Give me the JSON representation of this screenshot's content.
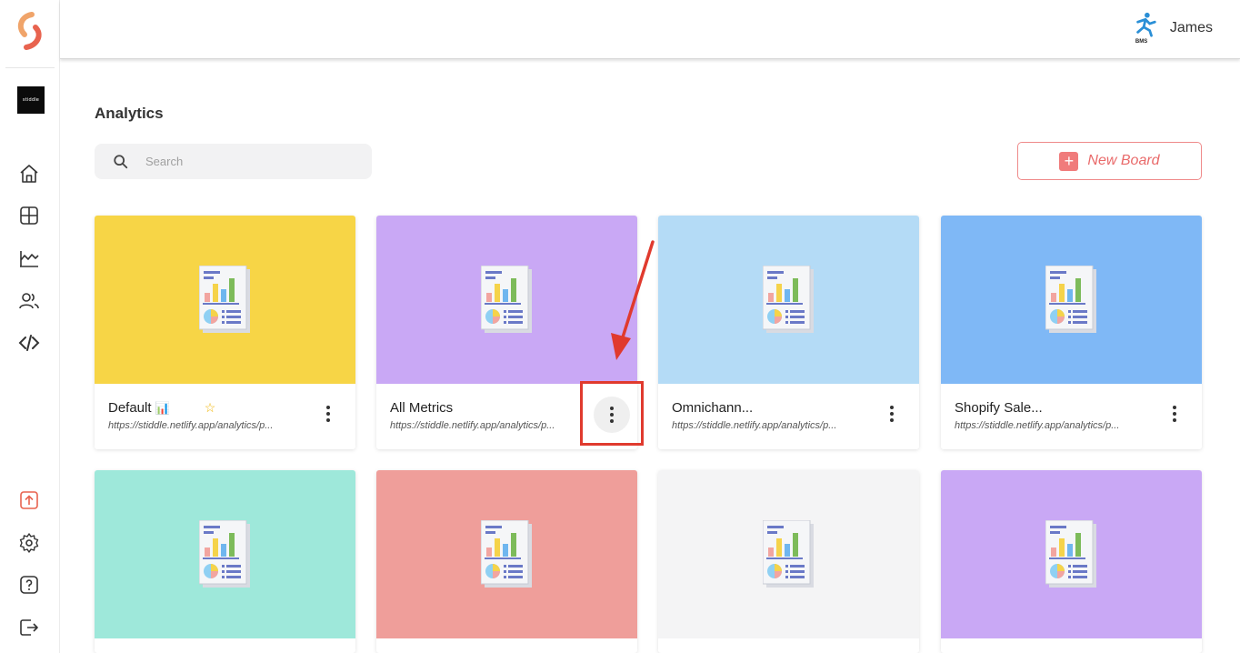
{
  "workspace": {
    "label": "stiddle"
  },
  "sidebar": {
    "items": [
      {
        "icon": "home-icon"
      },
      {
        "icon": "dashboard-grid-icon"
      },
      {
        "icon": "analytics-chart-icon"
      },
      {
        "icon": "users-icon"
      },
      {
        "icon": "code-icon"
      }
    ],
    "bottom_items": [
      {
        "icon": "upload-icon"
      },
      {
        "icon": "gear-icon"
      },
      {
        "icon": "help-icon"
      },
      {
        "icon": "logout-icon"
      }
    ]
  },
  "user": {
    "name": "James",
    "badge": "BMS"
  },
  "page": {
    "title": "Analytics"
  },
  "search": {
    "placeholder": "Search",
    "value": ""
  },
  "new_board": {
    "label": "New Board",
    "icon": "plus-icon"
  },
  "cards": [
    {
      "title": "Default",
      "emoji": "📊",
      "starred": true,
      "url": "https://stiddle.netlify.app/analytics/p...",
      "color": "#f7d546"
    },
    {
      "title": "All Metrics",
      "url": "https://stiddle.netlify.app/analytics/p...",
      "color": "#c9a8f5"
    },
    {
      "title": "Omnichann...",
      "url": "https://stiddle.netlify.app/analytics/p...",
      "color": "#b4dbf6"
    },
    {
      "title": "Shopify Sale...",
      "url": "https://stiddle.netlify.app/analytics/p...",
      "color": "#7fb8f6"
    },
    {
      "title": "",
      "url": "",
      "color": "#9ee8da"
    },
    {
      "title": "",
      "url": "",
      "color": "#ef9e9a"
    },
    {
      "title": "",
      "url": "",
      "color": "#f4f4f5"
    },
    {
      "title": "",
      "url": "",
      "color": "#c9a8f5"
    }
  ],
  "colors": {
    "accent": "#f07b7b",
    "annotation": "#e03a2e",
    "star": "#f0b400"
  }
}
